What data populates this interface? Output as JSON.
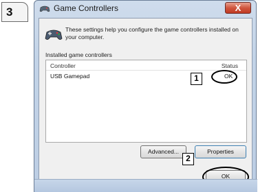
{
  "step": {
    "number": "3"
  },
  "window": {
    "title": "Game Controllers",
    "close_label": "X",
    "description": "These settings help you configure the game controllers installed on your computer.",
    "group_label": "Installed game controllers",
    "columns": {
      "controller": "Controller",
      "status": "Status"
    },
    "rows": [
      {
        "controller": "USB Gamepad",
        "status": "OK"
      }
    ]
  },
  "buttons": {
    "advanced": "Advanced...",
    "properties": "Properties",
    "ok": "OK"
  },
  "callouts": {
    "one": "1",
    "two": "2"
  },
  "icons": {
    "title": "game-controller-icon",
    "header": "game-controller-icon"
  },
  "colors": {
    "title_bar": "#c2d3e7",
    "close_button": "#c03a22",
    "client": "#f0f0f0"
  }
}
